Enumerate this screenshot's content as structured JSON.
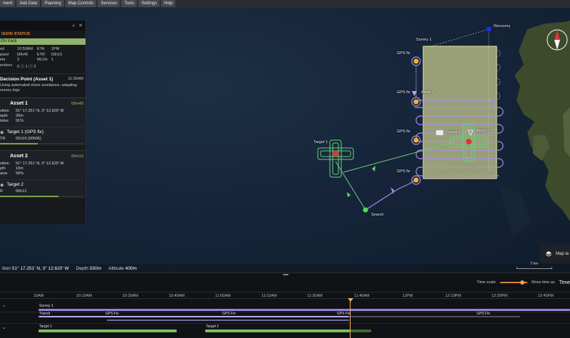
{
  "menu": [
    "ment",
    "Add Data",
    "Planning",
    "Map Controls",
    "Services",
    "Tools",
    "Settings",
    "Help"
  ],
  "panel": {
    "title": "ISION STATUS",
    "status": "On track",
    "stats": [
      {
        "k": "ed",
        "v": "10:50AM",
        "k2": "ETA",
        "v2": "1PM"
      },
      {
        "k": "psed",
        "v": "00h45",
        "k2": "ETR",
        "v2": "03h15"
      },
      {
        "k": "ets",
        "v": "2",
        "k2": "MLOs",
        "v2": "1"
      },
      {
        "k": "ectives",
        "v": "0 ⓘ 1 ⓘ 2",
        "k2": "",
        "v2": ""
      }
    ],
    "decision": {
      "title": "Decision Point (Asset 1)",
      "time": "11:35AM",
      "desc": "Using automated shore avoidance; adapting survey legs"
    },
    "assets": [
      {
        "name": "Asset 1",
        "duration": "00m43",
        "rows": [
          {
            "k": "sition",
            "v": "51° 17.251' N, 3° 12.620' W"
          },
          {
            "k": "epth",
            "v": "20m"
          },
          {
            "k": "tatus",
            "v": "91%"
          }
        ],
        "target": "Target 1 (GPS fix)",
        "target_rows": [
          {
            "k": "TR",
            "v": "01h19 (00h06)"
          }
        ],
        "progress": 0.45
      },
      {
        "name": "Asset 2",
        "duration": "00m13",
        "rows": [
          {
            "k": "sition",
            "v": "51° 17.251' N, 3° 12.620' W"
          },
          {
            "k": "pth",
            "v": "10m"
          },
          {
            "k": "atus",
            "v": "56%"
          }
        ],
        "target": "Target 2",
        "target_rows": [
          {
            "k": "R",
            "v": "00h12"
          }
        ],
        "progress": 0.7
      }
    ]
  },
  "map": {
    "labels": {
      "survey": "Survey 1",
      "recovery": "Recovery",
      "gps1": "GPS fix",
      "gps2": "GPS fix",
      "gps3": "GPS fix",
      "gps4": "GPS fix",
      "asset1": "Asset 1",
      "asset2": "Asset 2",
      "target1": "Target 1",
      "target2": "Target 2",
      "search": "Search"
    },
    "layers_label": "Map la",
    "scale": "3 km"
  },
  "statusbar": {
    "pos_label": "ition",
    "pos_value": "51° 17.251' N, 3° 12.620' W",
    "depth_label": "Depth",
    "depth_value": "550m",
    "alt_label": "Altitude",
    "alt_value": "400m"
  },
  "timeline": {
    "time_scale_label": "Time scale",
    "show_time_label": "Show time as",
    "show_time_value": "Time",
    "ticks": [
      "10AM",
      "10:10AM",
      "10:30AM",
      "10:45AM",
      "11:00AM",
      "11:15AM",
      "11:30AM",
      "11:40AM",
      "12PM",
      "12:10PM",
      "12:30PM",
      "12:45PM"
    ],
    "rows": {
      "survey": "Survey 1",
      "transit": "Transit",
      "gps1": "GPS Fix",
      "gps2": "GPS Fix",
      "gps3": "GPS Fix",
      "gps4": "GPS Fix",
      "target1": "Target 1",
      "target2": "Target 2"
    }
  }
}
